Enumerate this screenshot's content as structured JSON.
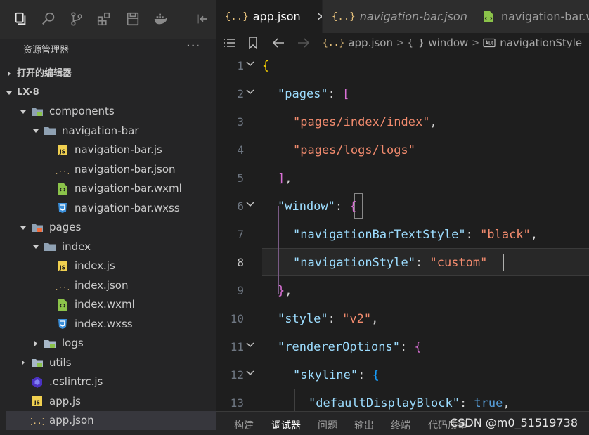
{
  "activity_bar": {
    "icons": [
      "explorer-icon",
      "search-icon",
      "source-control-icon",
      "extensions-icon",
      "storage-icon",
      "docker-icon",
      "collapse-panel-icon"
    ]
  },
  "sidebar": {
    "title": "资源管理器",
    "more": "···",
    "open_editors": "打开的编辑器",
    "project": "LX-8",
    "tree": [
      {
        "label": "components",
        "type": "folder"
      },
      {
        "label": "navigation-bar",
        "type": "folder"
      },
      {
        "label": "navigation-bar.js",
        "type": "js"
      },
      {
        "label": "navigation-bar.json",
        "type": "json"
      },
      {
        "label": "navigation-bar.wxml",
        "type": "wxml"
      },
      {
        "label": "navigation-bar.wxss",
        "type": "wxss"
      },
      {
        "label": "pages",
        "type": "folder"
      },
      {
        "label": "index",
        "type": "folder"
      },
      {
        "label": "index.js",
        "type": "js"
      },
      {
        "label": "index.json",
        "type": "json"
      },
      {
        "label": "index.wxml",
        "type": "wxml"
      },
      {
        "label": "index.wxss",
        "type": "wxss"
      },
      {
        "label": "logs",
        "type": "folder"
      },
      {
        "label": "utils",
        "type": "folder"
      },
      {
        "label": ".eslintrc.js",
        "type": "eslint"
      },
      {
        "label": "app.js",
        "type": "js"
      },
      {
        "label": "app.json",
        "type": "json"
      }
    ]
  },
  "tabs": [
    {
      "label": "app.json",
      "icon": "{..}",
      "close": "×"
    },
    {
      "label": "navigation-bar.json",
      "icon": "{..}"
    },
    {
      "label": "navigation-bar.wx",
      "icon": "wxml"
    }
  ],
  "breadcrumb": {
    "file": "app.json",
    "node1": "window",
    "node2": "navigationStyle"
  },
  "editor": {
    "line_numbers": [
      "1",
      "2",
      "3",
      "4",
      "5",
      "6",
      "7",
      "8",
      "9",
      "10",
      "11",
      "12",
      "13"
    ],
    "current_line": "8",
    "tokens": {
      "t_open": "{",
      "t_pages_key": "\"pages\"",
      "t_colon": ": ",
      "t_lbr": "[",
      "t_page1": "\"pages/index/index\"",
      "t_comma": ",",
      "t_page2": "\"pages/logs/logs\"",
      "t_rbr": "]",
      "t_window_key": "\"window\"",
      "t_obr": "{",
      "t_nbts_key": "\"navigationBarTextStyle\"",
      "t_black": "\"black\"",
      "t_ns_key": "\"navigationStyle\"",
      "t_custom": "\"custom\"",
      "t_cbr": "}",
      "t_style_key": "\"style\"",
      "t_v2": "\"v2\"",
      "t_ro_key": "\"rendererOptions\"",
      "t_obr2": "{",
      "t_skyline_key": "\"skyline\"",
      "t_obr3": "{",
      "t_ddb_key": "\"defaultDisplayBlock\"",
      "t_true": "true"
    }
  },
  "panel": {
    "tabs": [
      "构建",
      "调试器",
      "问题",
      "输出",
      "终端",
      "代码质量"
    ],
    "active": "调试器",
    "watermark": "CSDN @m0_51519738"
  },
  "colors": {
    "background": "#1e1e1e",
    "sidebar": "#252526",
    "key": "#9cdcfe",
    "string": "#f28b6e",
    "bracket_gold": "#ffd700",
    "bracket_purple": "#da70d6",
    "bracket_blue": "#179fff"
  }
}
